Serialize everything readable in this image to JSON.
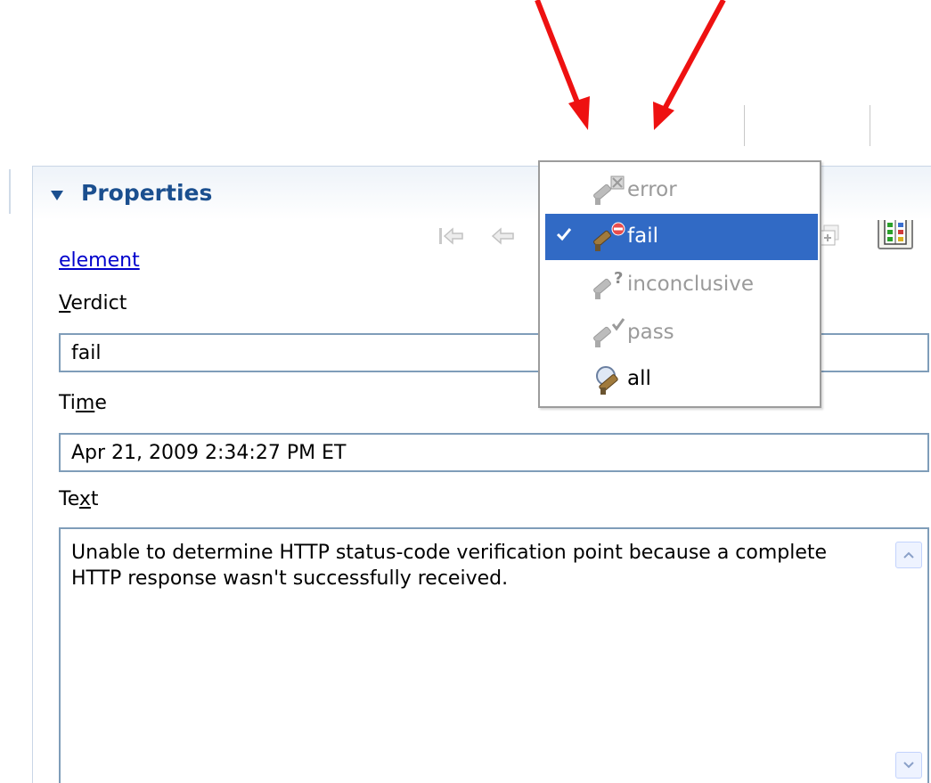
{
  "colors": {
    "annotation_arrow": "#ee1111",
    "accent": "#1b4f8f",
    "selection": "#316ac5",
    "link": "#0000cc",
    "field_border": "#7f9db9"
  },
  "toolbar": {
    "icons": [
      "first-icon",
      "previous-icon",
      "verdict-filter-icon",
      "dropdown-arrow-icon",
      "next-icon",
      "last-icon",
      "collapse-all-icon",
      "expand-all-icon",
      "layout-toggle-icon"
    ]
  },
  "menu": {
    "items": [
      {
        "label": "error",
        "enabled": false,
        "checked": false,
        "icon": "verdict-error-icon"
      },
      {
        "label": "fail",
        "enabled": true,
        "checked": true,
        "icon": "verdict-fail-icon"
      },
      {
        "label": "inconclusive",
        "enabled": false,
        "checked": false,
        "icon": "verdict-inconclusive-icon"
      },
      {
        "label": "pass",
        "enabled": false,
        "checked": false,
        "icon": "verdict-pass-icon"
      },
      {
        "label": "all",
        "enabled": true,
        "checked": false,
        "icon": "verdict-all-icon"
      }
    ]
  },
  "properties": {
    "title": "Properties",
    "link": "element",
    "verdict": {
      "label_prefix": "",
      "label_mnemonic": "V",
      "label_rest": "erdict",
      "value": "fail"
    },
    "time": {
      "label_prefix": "Ti",
      "label_mnemonic": "m",
      "label_rest": "e",
      "value": "Apr 21, 2009 2:34:27 PM ET"
    },
    "text": {
      "label_prefix": "Te",
      "label_mnemonic": "x",
      "label_rest": "t",
      "value": "Unable to determine HTTP status-code verification point because a complete HTTP response wasn't successfully received."
    }
  }
}
